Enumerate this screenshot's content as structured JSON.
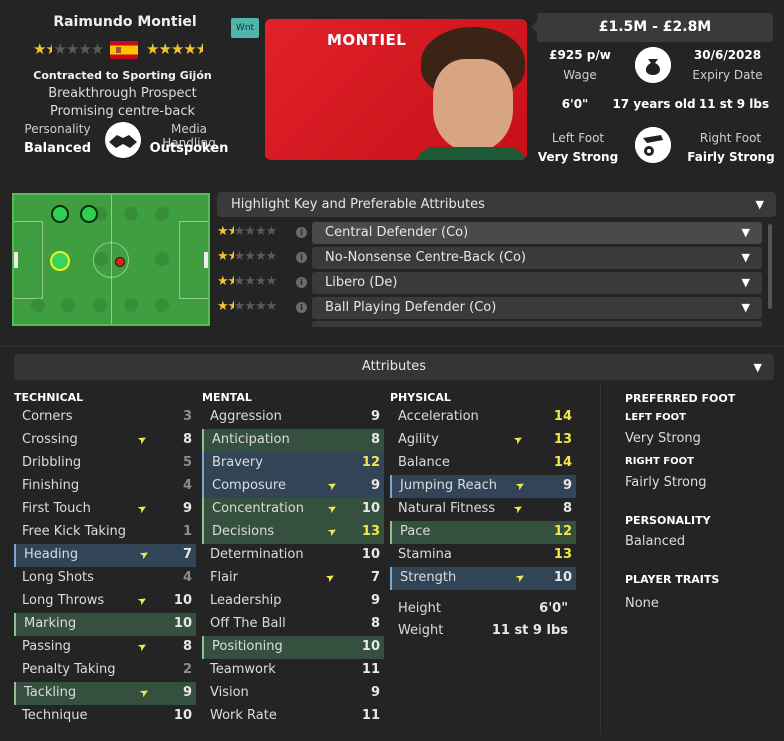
{
  "player": {
    "name": "Raimundo Montiel",
    "surname_card": "MONTIEL",
    "current_stars": 1.5,
    "potential_stars": 4.5,
    "wnt_badge": "Wnt",
    "contract_text": "Contracted to Sporting Gijón",
    "prospect": "Breakthrough Prospect",
    "role_desc": "Promising centre-back",
    "personality_label": "Personality",
    "personality_value": "Balanced",
    "media_label": "Media Handling",
    "media_value": "Outspoken"
  },
  "info": {
    "value_range": "£1.5M - £2.8M",
    "wage_value": "£925 p/w",
    "wage_label": "Wage",
    "expiry_value": "30/6/2028",
    "expiry_label": "Expiry Date",
    "height": "6'0\"",
    "age": "17 years old",
    "weight": "11 st 9 lbs",
    "left_foot_label": "Left Foot",
    "left_foot_value": "Very Strong",
    "right_foot_label": "Right Foot",
    "right_foot_value": "Fairly Strong"
  },
  "roles": {
    "header": "Highlight Key and Preferable Attributes",
    "items": [
      {
        "label": "Central Defender (Co)",
        "stars": 1.5
      },
      {
        "label": "No-Nonsense Centre-Back (Co)",
        "stars": 1.5
      },
      {
        "label": "Libero (De)",
        "stars": 1.5
      },
      {
        "label": "Ball Playing Defender (Co)",
        "stars": 1.5
      }
    ]
  },
  "attributes_bar": "Attributes",
  "technical": {
    "title": "TECHNICAL",
    "items": [
      {
        "name": "Corners",
        "value": "3",
        "arrow": false,
        "hl": "",
        "tone": "dim"
      },
      {
        "name": "Crossing",
        "value": "8",
        "arrow": true,
        "hl": "",
        "tone": ""
      },
      {
        "name": "Dribbling",
        "value": "5",
        "arrow": false,
        "hl": "",
        "tone": "dim"
      },
      {
        "name": "Finishing",
        "value": "4",
        "arrow": false,
        "hl": "",
        "tone": "dim"
      },
      {
        "name": "First Touch",
        "value": "9",
        "arrow": true,
        "hl": "",
        "tone": ""
      },
      {
        "name": "Free Kick Taking",
        "value": "1",
        "arrow": false,
        "hl": "",
        "tone": "dim"
      },
      {
        "name": "Heading",
        "value": "7",
        "arrow": true,
        "hl": "blue",
        "tone": ""
      },
      {
        "name": "Long Shots",
        "value": "4",
        "arrow": false,
        "hl": "",
        "tone": "dim"
      },
      {
        "name": "Long Throws",
        "value": "10",
        "arrow": true,
        "hl": "",
        "tone": ""
      },
      {
        "name": "Marking",
        "value": "10",
        "arrow": false,
        "hl": "green",
        "tone": ""
      },
      {
        "name": "Passing",
        "value": "8",
        "arrow": true,
        "hl": "",
        "tone": ""
      },
      {
        "name": "Penalty Taking",
        "value": "2",
        "arrow": false,
        "hl": "",
        "tone": "dim"
      },
      {
        "name": "Tackling",
        "value": "9",
        "arrow": true,
        "hl": "green",
        "tone": ""
      },
      {
        "name": "Technique",
        "value": "10",
        "arrow": false,
        "hl": "",
        "tone": ""
      }
    ]
  },
  "mental": {
    "title": "MENTAL",
    "items": [
      {
        "name": "Aggression",
        "value": "9",
        "arrow": false,
        "hl": "",
        "tone": ""
      },
      {
        "name": "Anticipation",
        "value": "8",
        "arrow": false,
        "hl": "green",
        "tone": ""
      },
      {
        "name": "Bravery",
        "value": "12",
        "arrow": false,
        "hl": "blue",
        "tone": "hi"
      },
      {
        "name": "Composure",
        "value": "9",
        "arrow": true,
        "hl": "blue",
        "tone": ""
      },
      {
        "name": "Concentration",
        "value": "10",
        "arrow": true,
        "hl": "green",
        "tone": ""
      },
      {
        "name": "Decisions",
        "value": "13",
        "arrow": true,
        "hl": "green",
        "tone": "hi"
      },
      {
        "name": "Determination",
        "value": "10",
        "arrow": false,
        "hl": "",
        "tone": ""
      },
      {
        "name": "Flair",
        "value": "7",
        "arrow": true,
        "hl": "",
        "tone": ""
      },
      {
        "name": "Leadership",
        "value": "9",
        "arrow": false,
        "hl": "",
        "tone": ""
      },
      {
        "name": "Off The Ball",
        "value": "8",
        "arrow": false,
        "hl": "",
        "tone": ""
      },
      {
        "name": "Positioning",
        "value": "10",
        "arrow": false,
        "hl": "green",
        "tone": ""
      },
      {
        "name": "Teamwork",
        "value": "11",
        "arrow": false,
        "hl": "",
        "tone": ""
      },
      {
        "name": "Vision",
        "value": "9",
        "arrow": false,
        "hl": "",
        "tone": ""
      },
      {
        "name": "Work Rate",
        "value": "11",
        "arrow": false,
        "hl": "",
        "tone": ""
      }
    ]
  },
  "physical": {
    "title": "PHYSICAL",
    "items": [
      {
        "name": "Acceleration",
        "value": "14",
        "arrow": false,
        "hl": "",
        "tone": "hi"
      },
      {
        "name": "Agility",
        "value": "13",
        "arrow": true,
        "hl": "",
        "tone": "hi"
      },
      {
        "name": "Balance",
        "value": "14",
        "arrow": false,
        "hl": "",
        "tone": "hi"
      },
      {
        "name": "Jumping Reach",
        "value": "9",
        "arrow": true,
        "hl": "blue",
        "tone": ""
      },
      {
        "name": "Natural Fitness",
        "value": "8",
        "arrow": true,
        "hl": "",
        "tone": ""
      },
      {
        "name": "Pace",
        "value": "12",
        "arrow": false,
        "hl": "green",
        "tone": "hi"
      },
      {
        "name": "Stamina",
        "value": "13",
        "arrow": false,
        "hl": "",
        "tone": "hi"
      },
      {
        "name": "Strength",
        "value": "10",
        "arrow": true,
        "hl": "blue",
        "tone": ""
      }
    ],
    "height_label": "Height",
    "height_value": "6'0\"",
    "weight_label": "Weight",
    "weight_value": "11 st 9 lbs"
  },
  "side": {
    "preferred_foot_title": "PREFERRED FOOT",
    "left_foot_title": "LEFT FOOT",
    "left_foot_value": "Very Strong",
    "right_foot_title": "RIGHT FOOT",
    "right_foot_value": "Fairly Strong",
    "personality_title": "PERSONALITY",
    "personality_value": "Balanced",
    "traits_title": "PLAYER TRAITS",
    "traits_value": "None"
  },
  "colors": {
    "accent_yellow": "#f2e84a",
    "highlight_green": "#35503f",
    "highlight_blue": "#314556",
    "card_red": "#d81a22"
  }
}
